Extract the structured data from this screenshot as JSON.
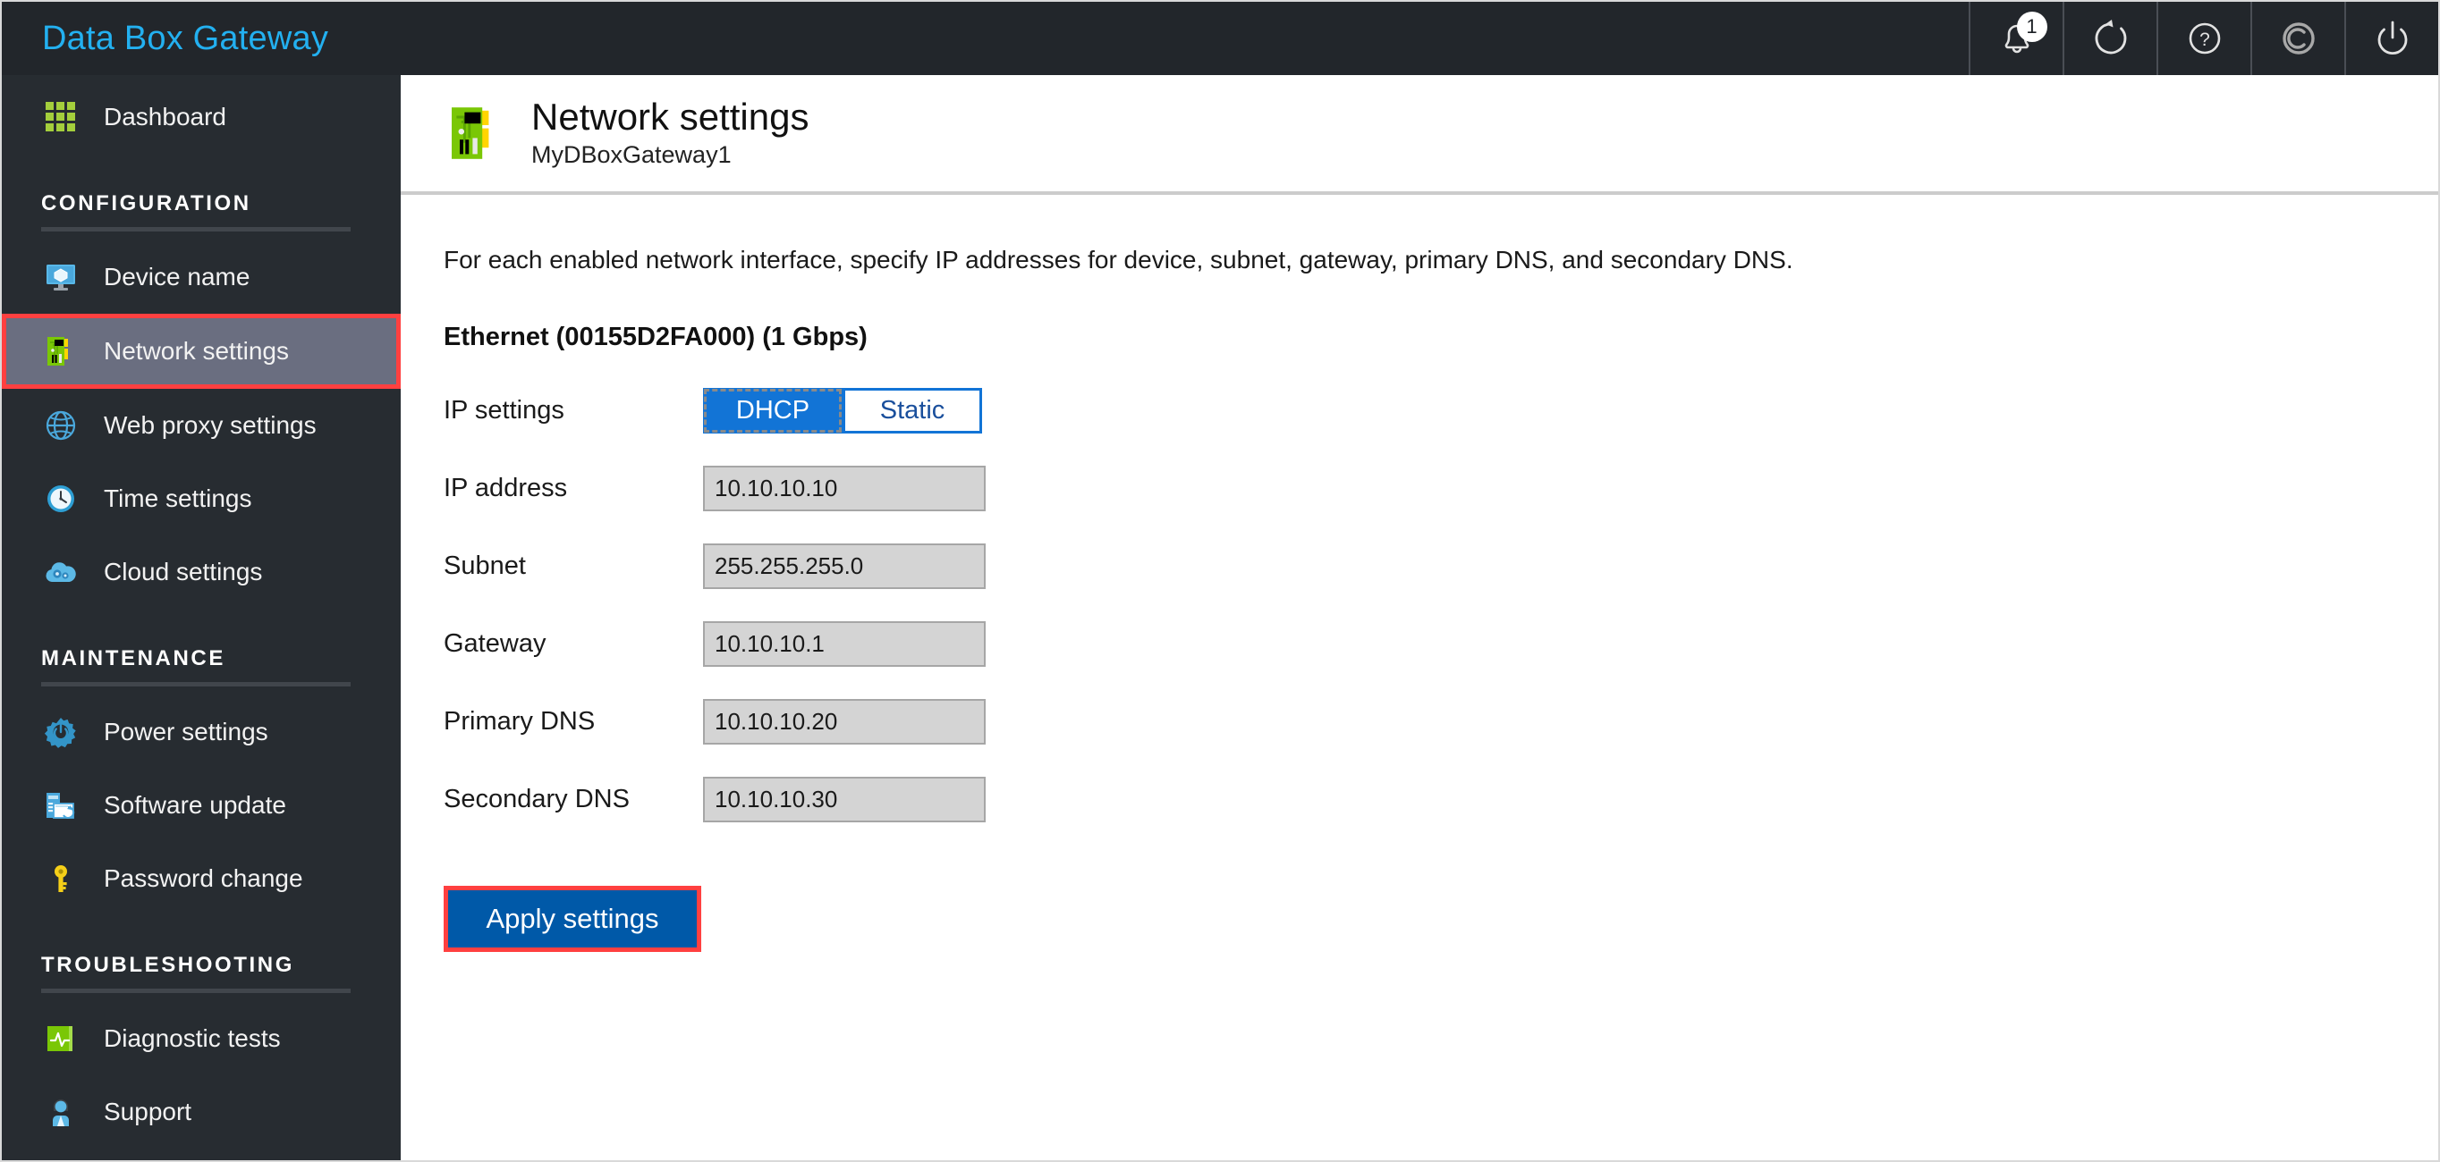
{
  "app": {
    "brand": "Data Box Gateway",
    "accent_blue": "#23b0f0",
    "topbar_bg": "#22262b",
    "sidebar_bg": "#272c31",
    "selected_bg": "#6a6e80",
    "annotation_red": "#ff4040",
    "primary_button_blue": "#0059a8",
    "segment_blue": "#1274d6"
  },
  "topbar": {
    "actions": [
      {
        "name": "notifications",
        "icon": "bell-icon",
        "badge": "1"
      },
      {
        "name": "refresh",
        "icon": "refresh-icon",
        "badge": ""
      },
      {
        "name": "help",
        "icon": "help-icon",
        "badge": ""
      },
      {
        "name": "copyright",
        "icon": "copyright-icon",
        "badge": ""
      },
      {
        "name": "power",
        "icon": "power-icon",
        "badge": ""
      }
    ]
  },
  "sidebar": {
    "dashboard": {
      "label": "Dashboard",
      "icon": "grid-icon"
    },
    "sections": [
      {
        "title": "CONFIGURATION",
        "items": [
          {
            "label": "Device name",
            "icon": "monitor-icon",
            "selected": false
          },
          {
            "label": "Network settings",
            "icon": "network-card-icon",
            "selected": true
          },
          {
            "label": "Web proxy settings",
            "icon": "globe-icon",
            "selected": false
          },
          {
            "label": "Time settings",
            "icon": "clock-icon",
            "selected": false
          },
          {
            "label": "Cloud settings",
            "icon": "cloud-gear-icon",
            "selected": false
          }
        ]
      },
      {
        "title": "MAINTENANCE",
        "items": [
          {
            "label": "Power settings",
            "icon": "gear-power-icon",
            "selected": false
          },
          {
            "label": "Software update",
            "icon": "software-update-icon",
            "selected": false
          },
          {
            "label": "Password change",
            "icon": "key-icon",
            "selected": false
          }
        ]
      },
      {
        "title": "TROUBLESHOOTING",
        "items": [
          {
            "label": "Diagnostic tests",
            "icon": "pulse-icon",
            "selected": false
          },
          {
            "label": "Support",
            "icon": "person-icon",
            "selected": false
          }
        ]
      }
    ]
  },
  "page": {
    "icon": "network-card-icon",
    "title": "Network settings",
    "subtitle": "MyDBoxGateway1",
    "intro": "For each enabled network interface, specify IP addresses for device, subnet, gateway, primary DNS, and secondary DNS.",
    "interface_title": "Ethernet (00155D2FA000) (1 Gbps)",
    "fields": {
      "ip_settings_label": "IP settings",
      "ip_settings_options": [
        "DHCP",
        "Static"
      ],
      "ip_settings_selected": "DHCP",
      "ip_address_label": "IP address",
      "ip_address_value": "10.10.10.10",
      "subnet_label": "Subnet",
      "subnet_value": "255.255.255.0",
      "gateway_label": "Gateway",
      "gateway_value": "10.10.10.1",
      "primary_dns_label": "Primary DNS",
      "primary_dns_value": "10.10.10.20",
      "secondary_dns_label": "Secondary DNS",
      "secondary_dns_value": "10.10.10.30"
    },
    "apply_label": "Apply settings"
  }
}
